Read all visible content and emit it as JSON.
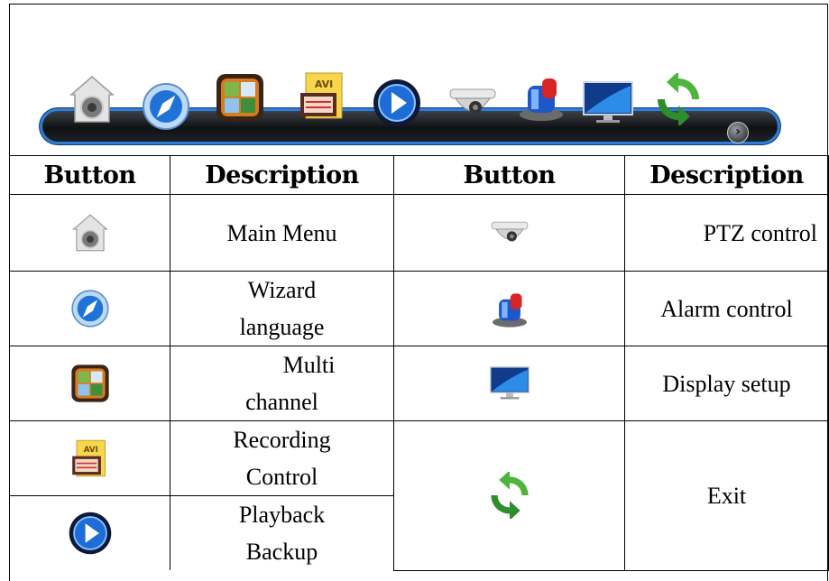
{
  "toolbar": {
    "icons": [
      "home-lock-icon",
      "compass-icon",
      "multi-channel-icon",
      "avi-record-icon",
      "play-icon",
      "dome-camera-icon",
      "alarm-siren-icon",
      "monitor-icon",
      "refresh-exit-icon"
    ],
    "more_glyph": "›",
    "accent_color": "#2d7ed8"
  },
  "table": {
    "headers": [
      "Button",
      "Description",
      "Button",
      "Description"
    ],
    "rows": [
      {
        "left_icon": "home-lock-icon",
        "left_text": "Main Menu",
        "right_icon": "dome-camera-icon",
        "right_text": "PTZ control"
      },
      {
        "left_icon": "compass-icon",
        "left_text": "Wizard language",
        "right_icon": "alarm-siren-icon",
        "right_text": "Alarm control"
      },
      {
        "left_icon": "multi-channel-icon",
        "left_text": "Multi channel",
        "right_icon": "monitor-icon",
        "right_text": "Display setup"
      },
      {
        "left_icon": "avi-record-icon",
        "left_text": "Recording Control",
        "right_icon": "refresh-exit-icon",
        "right_text": "Exit"
      },
      {
        "left_icon": "play-icon",
        "left_text": "Playback Backup"
      }
    ],
    "left_text_lines": [
      [
        "Main Menu"
      ],
      [
        "Wizard",
        "language"
      ],
      [
        "Multi",
        "channel"
      ],
      [
        "Recording",
        "Control"
      ],
      [
        "Playback",
        "Backup"
      ]
    ]
  }
}
